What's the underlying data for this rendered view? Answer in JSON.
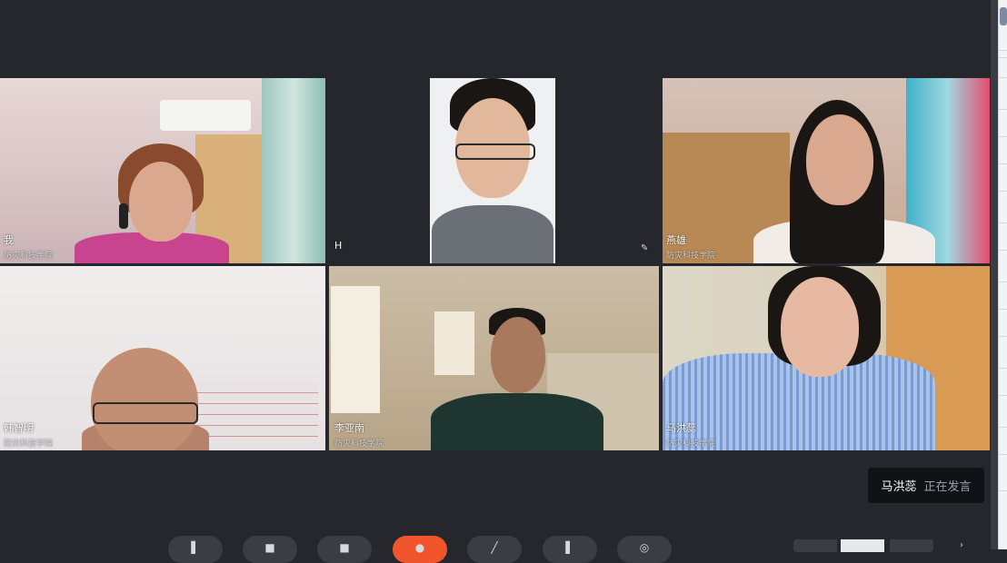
{
  "participants": [
    {
      "name": "我",
      "org": "防灾科技学院"
    },
    {
      "name": "H",
      "org": ""
    },
    {
      "name": "燕雄",
      "org": "防灾科技学院"
    },
    {
      "name": "韩智明",
      "org": "防灾科技学院"
    },
    {
      "name": "李亚南",
      "org": "防灾科技学院"
    },
    {
      "name": "马洪蕊",
      "org": "防灾科技学院"
    }
  ],
  "speaking": {
    "name": "马洪蕊",
    "status": "正在发言"
  },
  "toolbar": [
    "mic-icon",
    "camera-icon",
    "share-icon",
    "record-icon",
    "pen-icon",
    "members-icon",
    "settings-icon"
  ],
  "colors": {
    "active_border": "#26b34a",
    "end_button": "#f0552c",
    "background": "#25272c"
  }
}
